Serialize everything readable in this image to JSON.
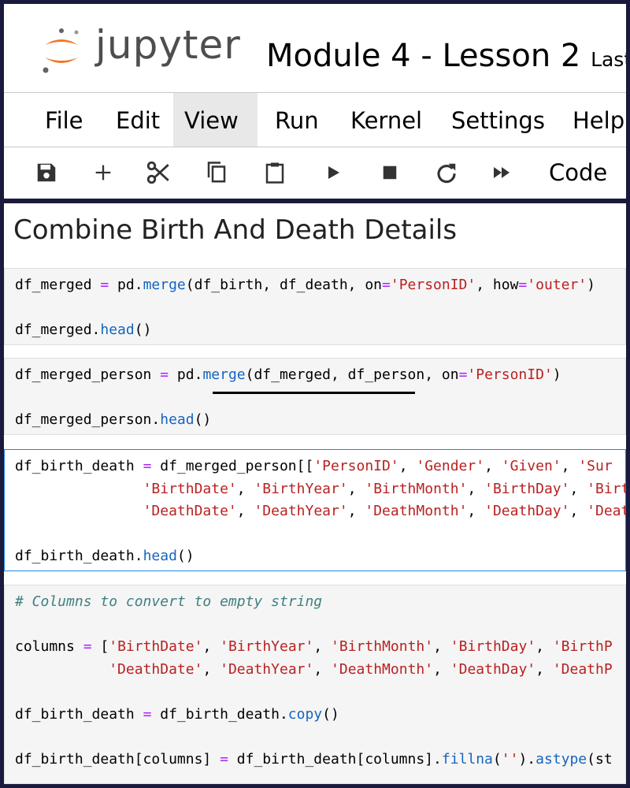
{
  "header": {
    "logo_text": "jupyter",
    "notebook_title": "Module 4 - Lesson 2",
    "last_saved_partial": "Last"
  },
  "menu": {
    "items": [
      "File",
      "Edit",
      "View",
      "Run",
      "Kernel",
      "Settings",
      "Help"
    ],
    "active": "View"
  },
  "toolbar": {
    "icons": [
      "save-icon",
      "add-cell-icon",
      "cut-icon",
      "copy-icon",
      "paste-icon",
      "run-icon",
      "stop-icon",
      "restart-icon",
      "fast-forward-icon"
    ],
    "cell_type": "Code"
  },
  "notebook": {
    "heading": "Combine Birth And Death Details",
    "cells": [
      {
        "lines": [
          [
            [
              "t",
              "df_merged "
            ],
            [
              "op",
              "="
            ],
            [
              "t",
              " pd."
            ],
            [
              "fn",
              "merge"
            ],
            [
              "t",
              "(df_birth, df_death, on"
            ],
            [
              "op",
              "="
            ],
            [
              "str",
              "'PersonID'"
            ],
            [
              "t",
              ", how"
            ],
            [
              "op",
              "="
            ],
            [
              "str",
              "'outer'"
            ],
            [
              "t",
              ")"
            ]
          ],
          [],
          [
            [
              "t",
              "df_merged."
            ],
            [
              "fn",
              "head"
            ],
            [
              "t",
              "()"
            ]
          ]
        ]
      },
      {
        "lines": [
          [
            [
              "t",
              "df_merged_person "
            ],
            [
              "op",
              "="
            ],
            [
              "t",
              " pd."
            ],
            [
              "fn",
              "merge"
            ],
            [
              "t",
              "(df_merged, df_person, on"
            ],
            [
              "op",
              "="
            ],
            [
              "str",
              "'PersonID'"
            ],
            [
              "t",
              ")"
            ]
          ],
          [],
          [
            [
              "t",
              "df_merged_person."
            ],
            [
              "fn",
              "head"
            ],
            [
              "t",
              "()"
            ]
          ]
        ]
      },
      {
        "selected": true,
        "lines": [
          [
            [
              "t",
              "df_birth_death "
            ],
            [
              "op",
              "="
            ],
            [
              "t",
              " df_merged_person[["
            ],
            [
              "str",
              "'PersonID'"
            ],
            [
              "t",
              ", "
            ],
            [
              "str",
              "'Gender'"
            ],
            [
              "t",
              ", "
            ],
            [
              "str",
              "'Given'"
            ],
            [
              "t",
              ", "
            ],
            [
              "str",
              "'Sur"
            ]
          ],
          [
            [
              "t",
              "               "
            ],
            [
              "str",
              "'BirthDate'"
            ],
            [
              "t",
              ", "
            ],
            [
              "str",
              "'BirthYear'"
            ],
            [
              "t",
              ", "
            ],
            [
              "str",
              "'BirthMonth'"
            ],
            [
              "t",
              ", "
            ],
            [
              "str",
              "'BirthDay'"
            ],
            [
              "t",
              ", "
            ],
            [
              "str",
              "'Birth"
            ]
          ],
          [
            [
              "t",
              "               "
            ],
            [
              "str",
              "'DeathDate'"
            ],
            [
              "t",
              ", "
            ],
            [
              "str",
              "'DeathYear'"
            ],
            [
              "t",
              ", "
            ],
            [
              "str",
              "'DeathMonth'"
            ],
            [
              "t",
              ", "
            ],
            [
              "str",
              "'DeathDay'"
            ],
            [
              "t",
              ", "
            ],
            [
              "str",
              "'Death"
            ]
          ],
          [],
          [
            [
              "t",
              "df_birth_death."
            ],
            [
              "fn",
              "head"
            ],
            [
              "t",
              "()"
            ]
          ]
        ]
      },
      {
        "lines": [
          [
            [
              "com",
              "# Columns to convert to empty string"
            ]
          ],
          [],
          [
            [
              "t",
              "columns "
            ],
            [
              "op",
              "="
            ],
            [
              "t",
              " ["
            ],
            [
              "str",
              "'BirthDate'"
            ],
            [
              "t",
              ", "
            ],
            [
              "str",
              "'BirthYear'"
            ],
            [
              "t",
              ", "
            ],
            [
              "str",
              "'BirthMonth'"
            ],
            [
              "t",
              ", "
            ],
            [
              "str",
              "'BirthDay'"
            ],
            [
              "t",
              ", "
            ],
            [
              "str",
              "'BirthP"
            ]
          ],
          [
            [
              "t",
              "           "
            ],
            [
              "str",
              "'DeathDate'"
            ],
            [
              "t",
              ", "
            ],
            [
              "str",
              "'DeathYear'"
            ],
            [
              "t",
              ", "
            ],
            [
              "str",
              "'DeathMonth'"
            ],
            [
              "t",
              ", "
            ],
            [
              "str",
              "'DeathDay'"
            ],
            [
              "t",
              ", "
            ],
            [
              "str",
              "'DeathP"
            ]
          ],
          [],
          [
            [
              "t",
              "df_birth_death "
            ],
            [
              "op",
              "="
            ],
            [
              "t",
              " df_birth_death."
            ],
            [
              "fn",
              "copy"
            ],
            [
              "t",
              "()"
            ]
          ],
          [],
          [
            [
              "t",
              "df_birth_death[columns] "
            ],
            [
              "op",
              "="
            ],
            [
              "t",
              " df_birth_death[columns]."
            ],
            [
              "fn",
              "fillna"
            ],
            [
              "t",
              "("
            ],
            [
              "str",
              "''"
            ],
            [
              "t",
              ")."
            ],
            [
              "fn",
              "astype"
            ],
            [
              "t",
              "(st"
            ]
          ]
        ]
      }
    ]
  },
  "colors": {
    "frame": "#1a1a3c",
    "logo_orange": "#f37726",
    "selected_border": "#1e88e5",
    "keyword_op": "#aa22ff",
    "function": "#1565c0",
    "string": "#ba2121",
    "comment": "#408080"
  }
}
